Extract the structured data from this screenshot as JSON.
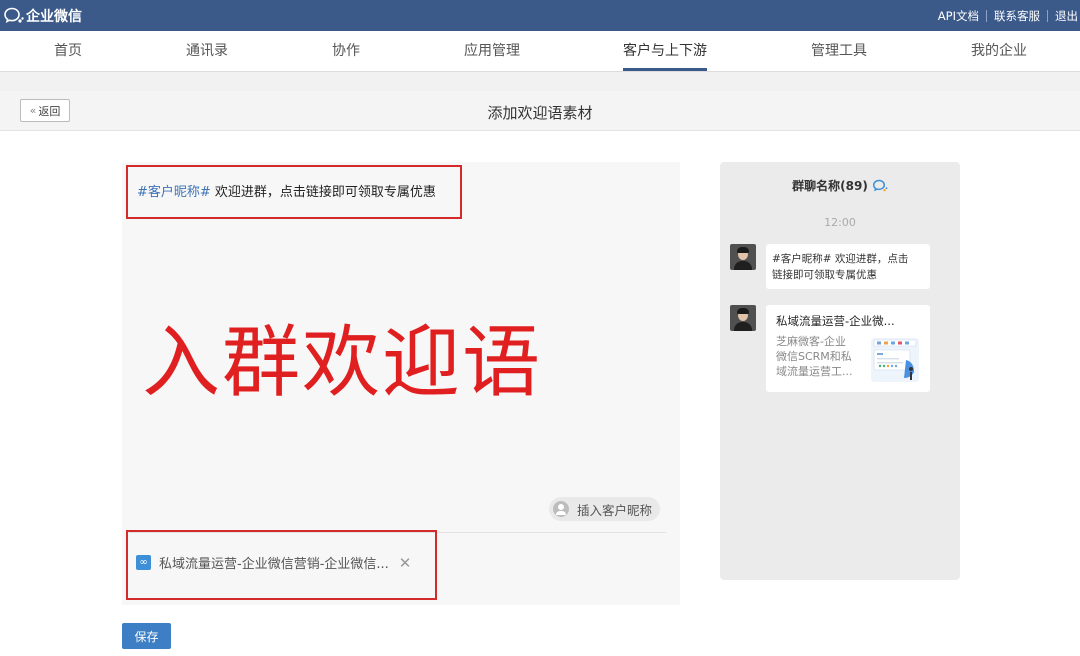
{
  "topbar": {
    "brand": "企业微信",
    "links": [
      "API文档",
      "联系客服",
      "退出"
    ],
    "bg_color": "#3b5a8a"
  },
  "nav": {
    "items": [
      "首页",
      "通讯录",
      "协作",
      "应用管理",
      "客户与上下游",
      "管理工具",
      "我的企业"
    ],
    "active": "客户与上下游"
  },
  "titlebar": {
    "back_label": "返回",
    "title": "添加欢迎语素材"
  },
  "editor": {
    "nickname_tag": "#客户昵称#",
    "welcome_message": " 欢迎进群，点击链接即可领取专属优惠",
    "insert_nickname_label": "插入客户昵称",
    "attachment_title": "私域流量运营-企业微信营销-企业微信...",
    "highlight_color": "#d42a2a"
  },
  "annotation": {
    "caption": "入群欢迎语",
    "color": "#e02020"
  },
  "save_label": "保存",
  "preview": {
    "group_name": "群聊名称(89)",
    "time": "12:00",
    "message_line1": "#客户昵称# 欢迎进群，点击",
    "message_line2": "链接即可领取专属优惠",
    "link_card": {
      "title": "私域流量运营-企业微...",
      "desc_line1": "芝麻微客-企业",
      "desc_line2": "微信SCRM和私",
      "desc_line3": "域流量运营工..."
    }
  }
}
